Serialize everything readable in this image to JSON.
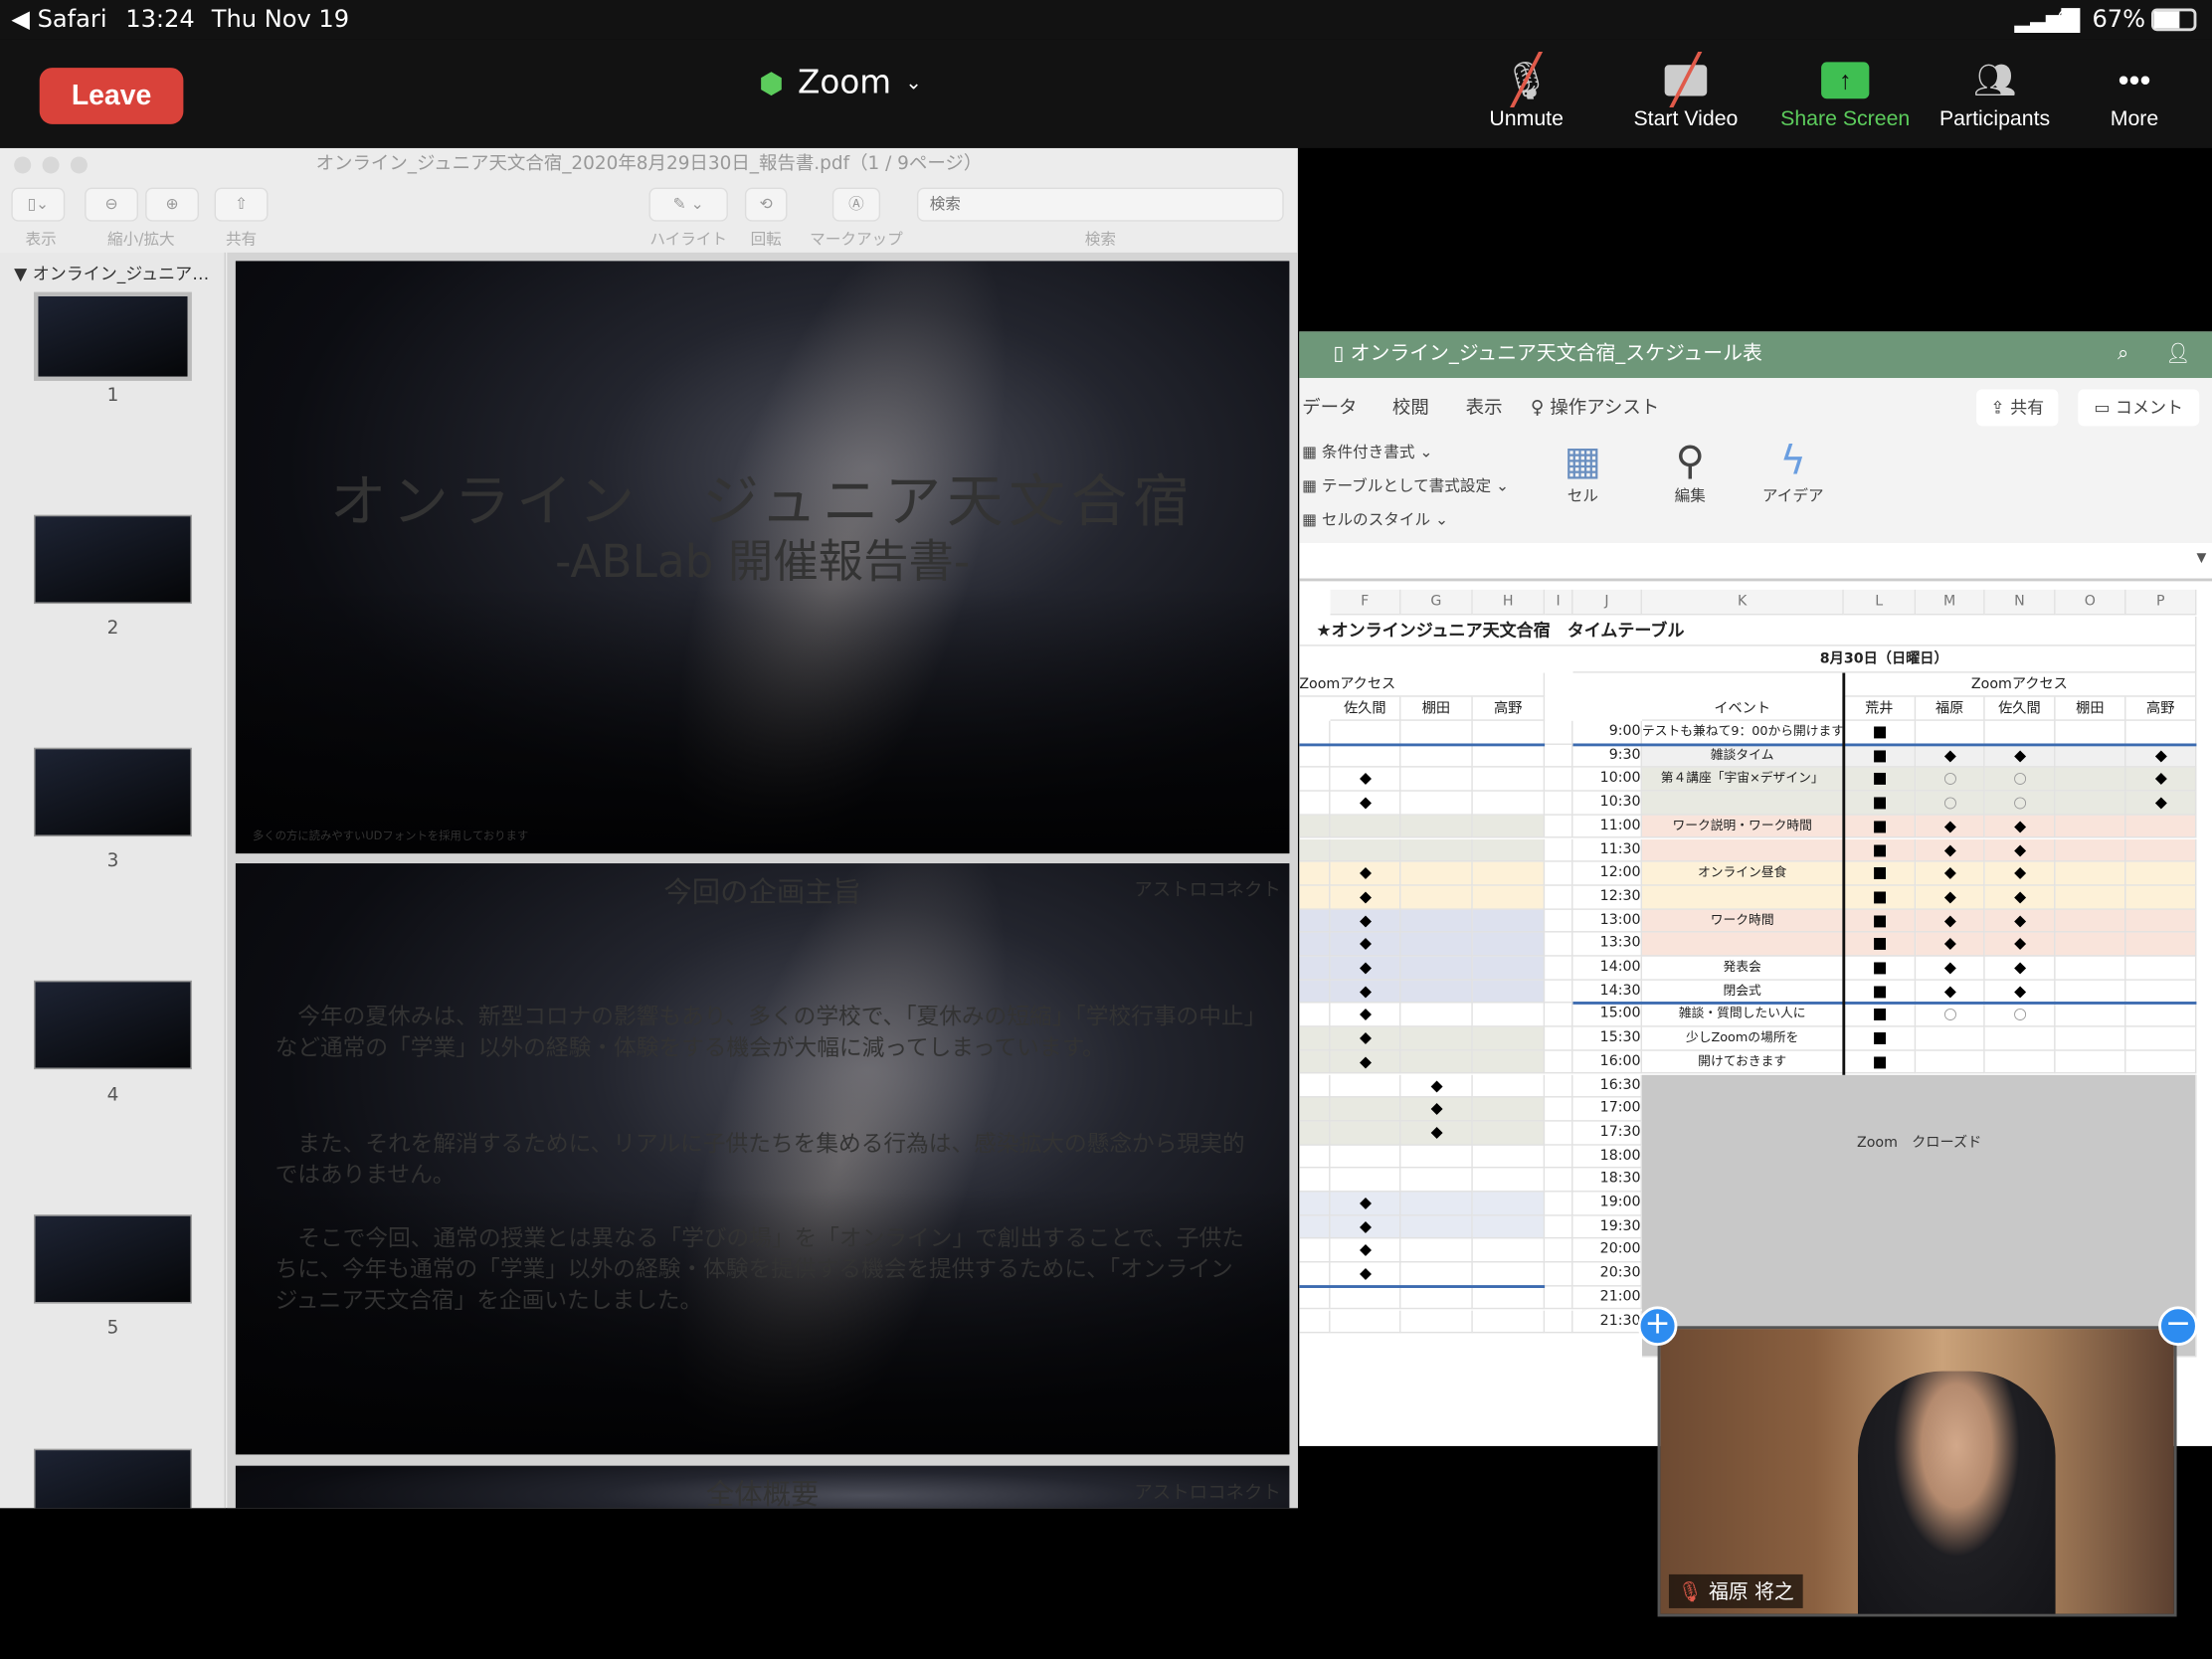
{
  "status": {
    "app_back": "Safari",
    "time": "13:24",
    "date": "Thu Nov 19",
    "battery": "67%"
  },
  "zoom": {
    "leave": "Leave",
    "meeting": "Zoom",
    "buttons": [
      {
        "label": "Unmute"
      },
      {
        "label": "Start Video"
      },
      {
        "label": "Share Screen"
      },
      {
        "label": "Participants"
      },
      {
        "label": "More"
      }
    ],
    "accent_green": "#5ccc5c",
    "leave_color": "#d9423a"
  },
  "pdf": {
    "title": "オンライン_ジュニア天文合宿_2020年8月29日30日_報告書.pdf（1 / 9ページ）",
    "toolbar": {
      "view": "表示",
      "zoom": "縮小/拡大",
      "share": "共有",
      "highlight": "ハイライト",
      "rotate": "回転",
      "markup": "マークアップ",
      "search": "検索",
      "search_placeholder": "検索"
    },
    "sidebar_title": "オンライン_ジュニア…",
    "pages": [
      "1",
      "2",
      "3",
      "4",
      "5"
    ],
    "slide1": {
      "title": "オンライン　ジュニア天文合宿",
      "subtitle": "-ABLab 開催報告書-",
      "note": "多くの方に読みやすいUDフォントを採用しております"
    },
    "slide2": {
      "heading": "今回の企画主旨",
      "logo": "アストロコネクト",
      "p1": "今年の夏休みは、新型コロナの影響もあり、多くの学校で、「夏休みの短縮」「学校行事の中止」など通常の「学業」以外の経験・体験をする機会が大幅に減ってしまっています。",
      "p2": "また、それを解消するために、リアルに子供たちを集める行為は、感染拡大の懸念から現実的ではありません。",
      "p3": "そこで今回、通常の授業とは異なる「学びの場」を「オンライン」で創出することで、子供たちに、今年も通常の「学業」以外の経験・体験を提供する機会を提供するために、「オンライン　ジュニア天文合宿」を企画いたしました。"
    },
    "slide3": {
      "heading": "全体概要",
      "logo": "アストロコネクト"
    }
  },
  "excel": {
    "title": "オンライン_ジュニア天文合宿_スケジュール表",
    "tabs": [
      "データ",
      "校閲",
      "表示",
      "操作アシスト"
    ],
    "share": "共有",
    "comment": "コメント",
    "ribbon": {
      "cond": "条件付き書式",
      "table": "テーブルとして書式設定",
      "style": "セルのスタイル",
      "cells": "セル",
      "edit": "編集",
      "ideas": "アイデア"
    },
    "columns": [
      "F",
      "G",
      "H",
      "I",
      "J",
      "K",
      "L",
      "M",
      "N",
      "O",
      "P"
    ],
    "sheet_title": "★オンラインジュニア天文合宿　タイムテーブル",
    "date": "8月30日（日曜日）",
    "zoom_access": "Zoomアクセス",
    "left_names": [
      "佐久間",
      "棚田",
      "高野"
    ],
    "event_header": "イベント",
    "right_names": [
      "荒井",
      "福原",
      "佐久間",
      "棚田",
      "高野"
    ],
    "closed": "Zoom　クローズド",
    "rows": [
      {
        "t": "9:00",
        "e": "テストも兼ねて9：00から開けます",
        "L": "sq"
      },
      {
        "t": "9:30",
        "e": "雑談タイム",
        "L": "sq",
        "M": "dia",
        "N": "dia",
        "P": "dia",
        "rb": "#f0f0f0"
      },
      {
        "t": "10:00",
        "e": "第４講座「宇宙×デザイン」",
        "L": "sq",
        "M": "cir",
        "N": "cir",
        "P": "dia",
        "F": "dia",
        "rb": "#e8e9e1"
      },
      {
        "t": "10:30",
        "e": "",
        "L": "sq",
        "M": "cir",
        "N": "cir",
        "P": "dia",
        "F": "dia",
        "rb": "#e8e9e1"
      },
      {
        "t": "11:00",
        "e": "ワーク説明・ワーク時間",
        "L": "sq",
        "M": "dia",
        "N": "dia",
        "rb": "#f9e4db",
        "lb": "#e8e9e1"
      },
      {
        "t": "11:30",
        "e": "",
        "L": "sq",
        "M": "dia",
        "N": "dia",
        "rb": "#f9e4db",
        "lb": "#e8e9e1"
      },
      {
        "t": "12:00",
        "e": "オンライン昼食",
        "L": "sq",
        "M": "dia",
        "N": "dia",
        "F": "dia",
        "rb": "#fdf1d8",
        "lb": "#fdf1d8"
      },
      {
        "t": "12:30",
        "e": "",
        "L": "sq",
        "M": "dia",
        "N": "dia",
        "F": "dia",
        "rb": "#fdf1d8",
        "lb": "#fdf1d8"
      },
      {
        "t": "13:00",
        "e": "ワーク時間",
        "L": "sq",
        "M": "dia",
        "N": "dia",
        "F": "dia",
        "rb": "#f9e4db",
        "lb": "#dde1ee"
      },
      {
        "t": "13:30",
        "e": "",
        "L": "sq",
        "M": "dia",
        "N": "dia",
        "F": "dia",
        "rb": "#f9e4db",
        "lb": "#dde1ee"
      },
      {
        "t": "14:00",
        "e": "発表会",
        "L": "sq",
        "M": "dia",
        "N": "dia",
        "F": "dia",
        "lb": "#dde1ee"
      },
      {
        "t": "14:30",
        "e": "閉会式",
        "L": "sq",
        "M": "dia",
        "N": "dia",
        "F": "dia",
        "lb": "#dde1ee"
      },
      {
        "t": "15:00",
        "e": "雑談・質問したい人に",
        "L": "sq",
        "M": "cir",
        "N": "cir",
        "F": "dia"
      },
      {
        "t": "15:30",
        "e": "少しZoomの場所を",
        "L": "sq",
        "F": "dia",
        "lb": "#e8e9e1"
      },
      {
        "t": "16:00",
        "e": "開けておきます",
        "L": "sq",
        "F": "dia",
        "lb": "#e8e9e1"
      },
      {
        "t": "16:30",
        "G": "dia"
      },
      {
        "t": "17:00",
        "G": "dia",
        "lb": "#e8e9e1"
      },
      {
        "t": "17:30",
        "G": "dia",
        "lb": "#e8e9e1"
      },
      {
        "t": "18:00"
      },
      {
        "t": "18:30"
      },
      {
        "t": "19:00",
        "F": "dia",
        "lb": "#e6eaf3"
      },
      {
        "t": "19:30",
        "F": "dia",
        "lb": "#e6eaf3"
      },
      {
        "t": "20:00",
        "F": "dia"
      },
      {
        "t": "20:30",
        "F": "dia"
      },
      {
        "t": "21:00"
      },
      {
        "t": "21:30"
      }
    ]
  },
  "video": {
    "participant": "福原 将之"
  }
}
